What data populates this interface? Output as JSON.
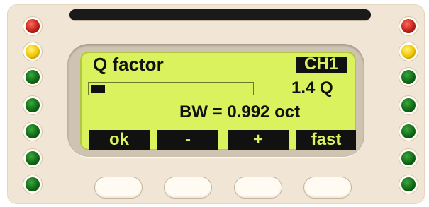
{
  "display": {
    "title": "Q factor",
    "channel": "CH1",
    "q_level_fraction": 0.09,
    "q_value": "1.4 Q",
    "bandwidth": "BW = 0.992 oct"
  },
  "softkeys": [
    {
      "label": "ok"
    },
    {
      "label": "-"
    },
    {
      "label": "+"
    },
    {
      "label": "fast"
    }
  ],
  "leds": {
    "left": [
      "red",
      "yellow",
      "green",
      "green",
      "green",
      "green",
      "green"
    ],
    "right": [
      "red",
      "yellow",
      "green",
      "green",
      "green",
      "green",
      "green"
    ]
  },
  "colors": {
    "lcd_background": "#d9f25d",
    "lcd_ink": "#111111",
    "panel": "#f1e6d6",
    "led_red": "#c0201a",
    "led_yellow": "#f0c400",
    "led_green": "#0e6214"
  }
}
